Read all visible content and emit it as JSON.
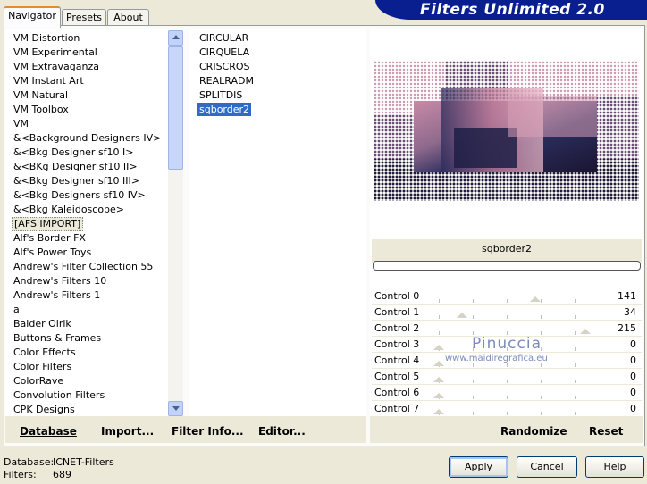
{
  "app": {
    "title": "Filters Unlimited 2.0"
  },
  "tabs": [
    {
      "label": "Navigator",
      "active": true
    },
    {
      "label": "Presets",
      "active": false
    },
    {
      "label": "About",
      "active": false
    }
  ],
  "categories": {
    "items": [
      "VM Distortion",
      "VM Experimental",
      "VM Extravaganza",
      "VM Instant Art",
      "VM Natural",
      "VM Toolbox",
      "VM",
      "&<Background Designers IV>",
      "&<Bkg Designer sf10 I>",
      "&<BKg Designer sf10 II>",
      "&<Bkg Designer sf10 III>",
      "&<Bkg Designers sf10 IV>",
      "&<Bkg Kaleidoscope>",
      "[AFS IMPORT]",
      "Alf's Border FX",
      "Alf's Power Toys",
      "Andrew's Filter Collection 55",
      "Andrew's Filters 10",
      "Andrew's Filters 1",
      "a",
      "Balder Olrik",
      "Buttons & Frames",
      "Color Effects",
      "Color Filters",
      "ColorRave",
      "Convolution Filters",
      "CPK Designs"
    ],
    "selected_index": 13
  },
  "filters": {
    "items": [
      "CIRCULAR",
      "CIRQUELA",
      "CRISCROS",
      "REALRADM",
      "SPLITDIS",
      "sqborder2"
    ],
    "selected_index": 5
  },
  "preview": {
    "filter_name": "sqborder2"
  },
  "controls": [
    {
      "label": "Control 0",
      "value": "141"
    },
    {
      "label": "Control 1",
      "value": "34"
    },
    {
      "label": "Control 2",
      "value": "215"
    },
    {
      "label": "Control 3",
      "value": "0"
    },
    {
      "label": "Control 4",
      "value": "0"
    },
    {
      "label": "Control 5",
      "value": "0"
    },
    {
      "label": "Control 6",
      "value": "0"
    },
    {
      "label": "Control 7",
      "value": "0"
    }
  ],
  "left_buttons": {
    "database": "Database",
    "import": "Import...",
    "filter_info": "Filter Info...",
    "editor": "Editor..."
  },
  "right_buttons": {
    "randomize": "Randomize",
    "reset": "Reset"
  },
  "watermark": {
    "name": "Pinuccia",
    "url": "www.maidiregrafica.eu"
  },
  "status": {
    "database_label": "Database:",
    "database_value": "ICNET-Filters",
    "filters_label": "Filters:",
    "filters_value": "689"
  },
  "dialog_buttons": {
    "apply": "Apply",
    "cancel": "Cancel",
    "help": "Help"
  }
}
